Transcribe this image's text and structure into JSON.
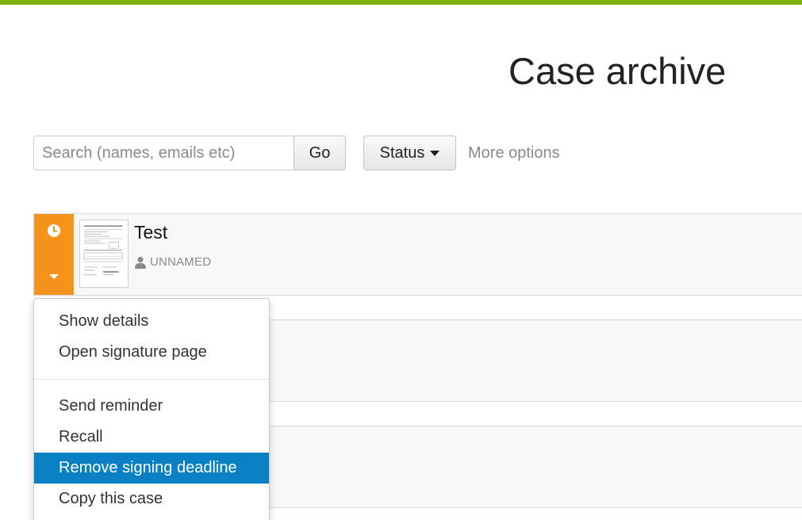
{
  "page": {
    "title": "Case archive",
    "accent_color": "#80b00e"
  },
  "search": {
    "placeholder": "Search (names, emails etc)",
    "value": "",
    "go_label": "Go"
  },
  "filters": {
    "status_label": "Status",
    "more_options_label": "More options"
  },
  "cases": [
    {
      "title": "Test",
      "party": "UNNAMED",
      "status_color": "#f6931a",
      "status_icon": "clock-icon",
      "toggle_icon": "caret-down-icon",
      "thumbnail": "document-thumbnail"
    }
  ],
  "context_menu": {
    "groups": [
      [
        "Show details",
        "Open signature page"
      ],
      [
        "Send reminder",
        "Recall",
        "Remove signing deadline",
        "Copy this case"
      ]
    ],
    "highlighted_item": "Remove signing deadline",
    "highlight_color": "#0a80c4"
  }
}
